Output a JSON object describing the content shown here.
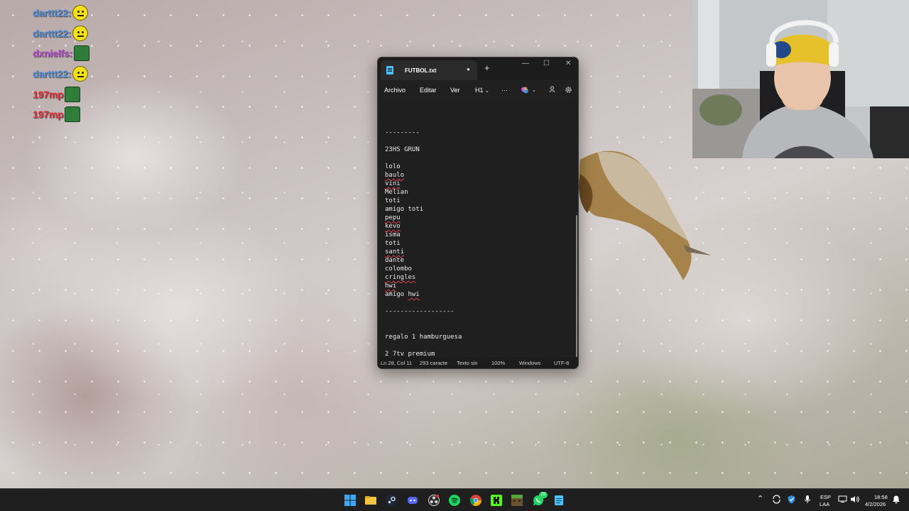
{
  "chat": [
    {
      "user": "darttt22:",
      "color": "#4f8dd6",
      "emote": "smiley-emote"
    },
    {
      "user": "darttt22:",
      "color": "#4f8dd6",
      "emote": "smiley-emote"
    },
    {
      "user": "dxnielfs:",
      "color": "#b84bd4",
      "emote": "green-emote"
    },
    {
      "user": "darttt22:",
      "color": "#4f8dd6",
      "emote": "smiley-emote"
    },
    {
      "user": "197mp",
      "color": "#e0303a",
      "emote": "green-emote"
    },
    {
      "user": "197mp",
      "color": "#e0303a",
      "emote": "green-emote"
    }
  ],
  "notepad": {
    "tab_title": "FUTBOL.txt",
    "tab_close": "●",
    "new_tab": "+",
    "window_controls": {
      "minimize": "—",
      "maximize": "☐",
      "close": "✕"
    },
    "menu": {
      "file": "Archivo",
      "edit": "Editar",
      "view": "Ver",
      "heading": "H1",
      "more": "···"
    },
    "lines": [
      {
        "text": "---------",
        "squiggle": false
      },
      {
        "text": "",
        "squiggle": false
      },
      {
        "text": "23HS GRUN",
        "squiggle": false
      },
      {
        "text": "",
        "squiggle": false
      },
      {
        "text": "lolo",
        "squiggle": false
      },
      {
        "text": "baulo",
        "squiggle": true
      },
      {
        "text": "vini",
        "squiggle": true
      },
      {
        "text": "Melian",
        "squiggle": false
      },
      {
        "text": "toti",
        "squiggle": false
      },
      {
        "text": "amigo toti",
        "squiggle": false
      },
      {
        "text": "pepu",
        "squiggle": true
      },
      {
        "text": "kevo",
        "squiggle": true
      },
      {
        "text": "isma",
        "squiggle": false
      },
      {
        "text": "toti",
        "squiggle": false
      },
      {
        "text": "santi",
        "squiggle": true
      },
      {
        "text": "dante",
        "squiggle": false
      },
      {
        "text": "colombo",
        "squiggle": false
      },
      {
        "text": "cringles",
        "squiggle": true
      },
      {
        "text": "hwi",
        "squiggle": true
      },
      {
        "text": "amigo hwi",
        "squiggle": false,
        "squiggle_word": "hwi"
      },
      {
        "text": "",
        "squiggle": false
      },
      {
        "text": "------------------",
        "squiggle": false
      },
      {
        "text": "",
        "squiggle": false
      },
      {
        "text": "",
        "squiggle": false
      },
      {
        "text": "regalo 1 hamburguesa",
        "squiggle": false
      },
      {
        "text": "",
        "squiggle": false
      },
      {
        "text": "2 7tv premium",
        "squiggle": false
      }
    ],
    "status": {
      "position": "Ln 28, Col 11",
      "chars": "293 caracte",
      "format": "Texto sin",
      "zoom": "100%",
      "line_ending": "Windows",
      "encoding": "UTF-8"
    }
  },
  "taskbar": {
    "whatsapp_badge": "29",
    "lang_top": "ESP",
    "lang_bottom": "LAA",
    "time": "18:58",
    "date": "4/2/2026"
  }
}
